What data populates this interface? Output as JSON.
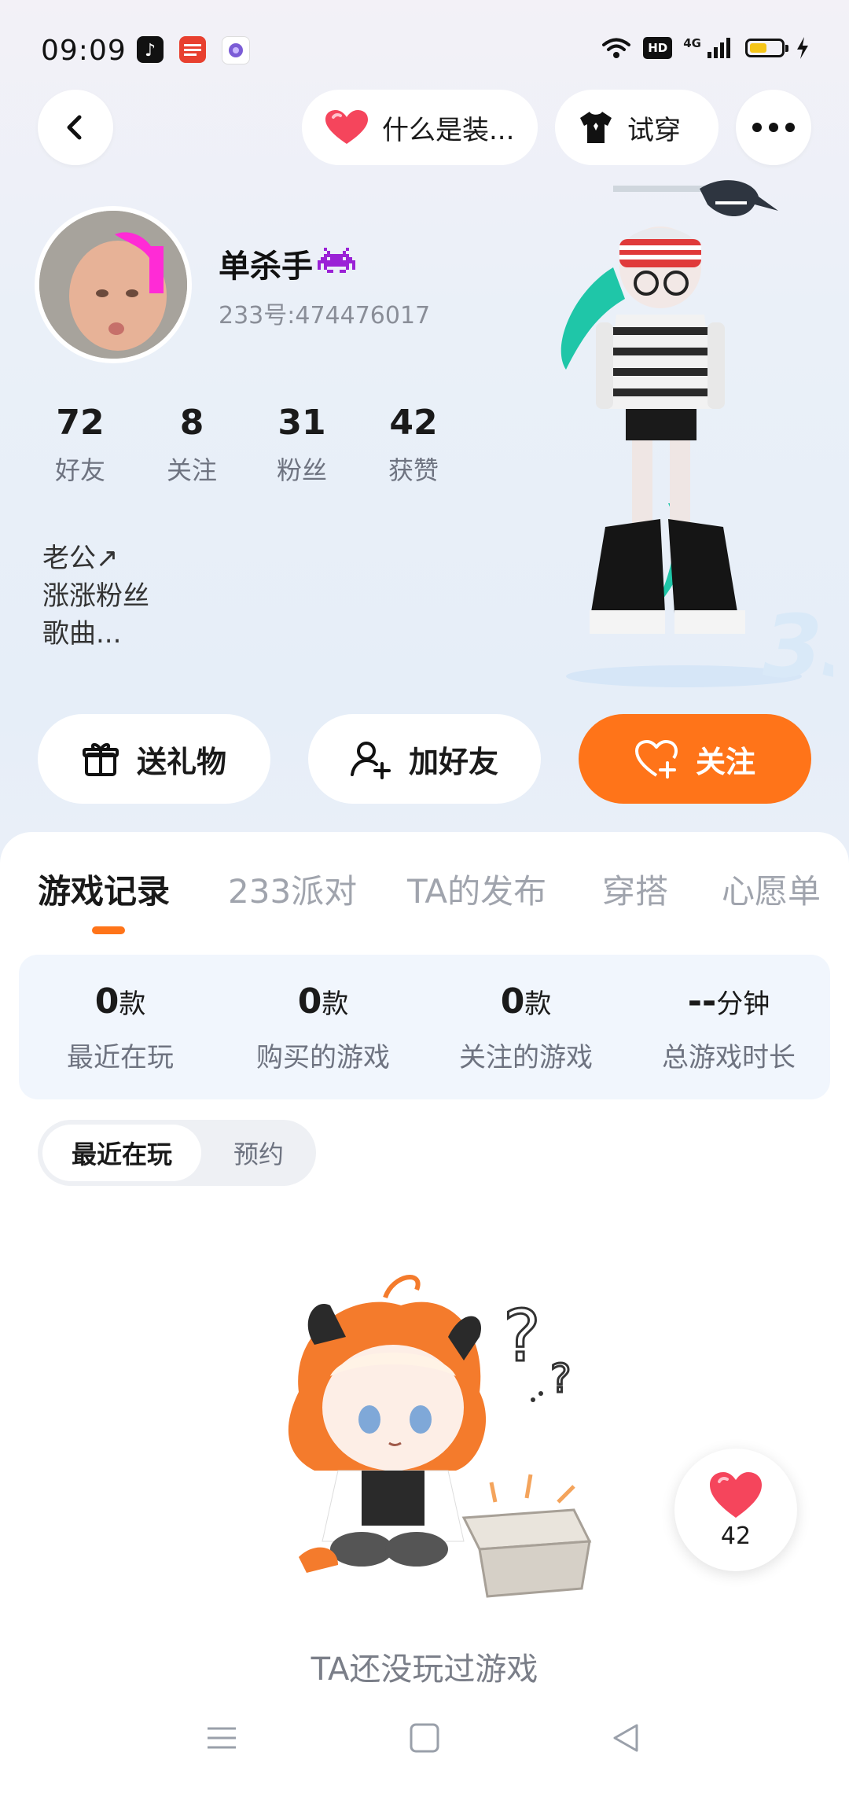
{
  "status_bar": {
    "time": "09:09",
    "apps": [
      "douyin-app-icon",
      "toutiao-app-icon",
      "assistant-app-icon"
    ],
    "hd_label": "HD",
    "network_label": "4G",
    "battery_level": 0.55
  },
  "top_bar": {
    "dress_info_label": "什么是装...",
    "try_on_label": "试穿"
  },
  "profile": {
    "username": "单杀手",
    "user_id": "233号:474476017",
    "stats": [
      {
        "value": "72",
        "label": "好友"
      },
      {
        "value": "8",
        "label": "关注"
      },
      {
        "value": "31",
        "label": "粉丝"
      },
      {
        "value": "42",
        "label": "获赞"
      }
    ],
    "bio_lines": [
      "老公↗",
      "涨涨粉丝",
      "歌曲..."
    ]
  },
  "actions": {
    "gift_label": "送礼物",
    "add_friend_label": "加好友",
    "follow_label": "关注"
  },
  "tabs": [
    "游戏记录",
    "233派对",
    "TA的发布",
    "穿搭",
    "心愿单"
  ],
  "game_stats": [
    {
      "value": "0",
      "unit": "款",
      "label": "最近在玩"
    },
    {
      "value": "0",
      "unit": "款",
      "label": "购买的游戏"
    },
    {
      "value": "0",
      "unit": "款",
      "label": "关注的游戏"
    },
    {
      "value": "--",
      "unit": "分钟",
      "label": "总游戏时长"
    }
  ],
  "segment": {
    "active": "最近在玩",
    "inactive": "预约"
  },
  "empty_state": {
    "text": "TA还没玩过游戏"
  },
  "like_float": {
    "count": "42"
  },
  "colors": {
    "accent": "#ff7419",
    "heart": "#f5455c"
  }
}
